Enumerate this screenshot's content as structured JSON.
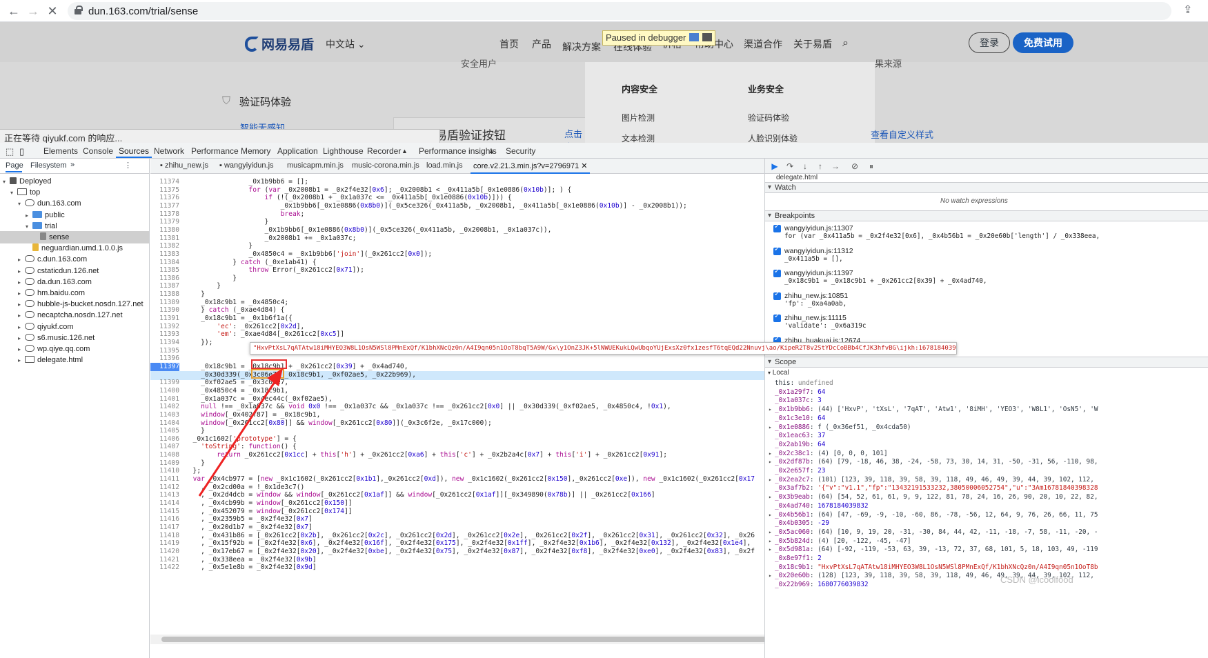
{
  "browser": {
    "url": "dun.163.com/trial/sense",
    "back_icon": "arrow-left-icon",
    "forward_icon": "arrow-right-icon",
    "stop_icon": "close-icon"
  },
  "site": {
    "logo": "网易易盾",
    "lang": "中文站",
    "nav": [
      "首页",
      "产品",
      "解决方案",
      "在线体验",
      "价格",
      "帮助中心",
      "渠道合作",
      "关于易盾"
    ],
    "login": "登录",
    "free_trial": "免费试用",
    "paused": "Paused in debugger",
    "left_heading": "验证码体验",
    "left_link": "智能无感知",
    "center_heading": "独立易盾验证按钮",
    "center_link": "点击查",
    "right_link": "查看自定义样式",
    "menu_cat1": "内容安全",
    "menu_cat2": "业务安全",
    "menu_items1": [
      "图片检测",
      "文本检测"
    ],
    "menu_items2": [
      "验证码体验",
      "人脸识别体验"
    ],
    "cut_text1": "安全用户",
    "cut_text2": "果来源",
    "status": "正在等待 qiyukf.com 的响应..."
  },
  "devtools": {
    "tabs": [
      "Elements",
      "Console",
      "Sources",
      "Network",
      "Performance",
      "Memory",
      "Application",
      "Lighthouse",
      "Recorder",
      "Performance insights",
      "Security"
    ],
    "selected_tab": "Sources",
    "nav_tabs": [
      "Page",
      "Filesystem"
    ],
    "tree": [
      {
        "label": "Deployed",
        "depth": 0,
        "kind": "cube"
      },
      {
        "label": "top",
        "depth": 1,
        "kind": "frame"
      },
      {
        "label": "dun.163.com",
        "depth": 2,
        "kind": "cloud"
      },
      {
        "label": "public",
        "depth": 3,
        "kind": "folder"
      },
      {
        "label": "trial",
        "depth": 3,
        "kind": "folder"
      },
      {
        "label": "sense",
        "depth": 4,
        "kind": "file",
        "selected": true
      },
      {
        "label": "neguardian.umd.1.0.0.js",
        "depth": 3,
        "kind": "jsfile"
      },
      {
        "label": "c.dun.163.com",
        "depth": 2,
        "kind": "cloud"
      },
      {
        "label": "cstaticdun.126.net",
        "depth": 2,
        "kind": "cloud"
      },
      {
        "label": "da.dun.163.com",
        "depth": 2,
        "kind": "cloud"
      },
      {
        "label": "hm.baidu.com",
        "depth": 2,
        "kind": "cloud"
      },
      {
        "label": "hubble-js-bucket.nosdn.127.net",
        "depth": 2,
        "kind": "cloud"
      },
      {
        "label": "necaptcha.nosdn.127.net",
        "depth": 2,
        "kind": "cloud"
      },
      {
        "label": "qiyukf.com",
        "depth": 2,
        "kind": "cloud"
      },
      {
        "label": "s6.music.126.net",
        "depth": 2,
        "kind": "cloud"
      },
      {
        "label": "wp.qiye.qq.com",
        "depth": 2,
        "kind": "cloud"
      },
      {
        "label": "delegate.html",
        "depth": 2,
        "kind": "frame"
      }
    ],
    "file_tabs": [
      "zhihu_new.js",
      "wangyiyidun.js",
      "musicapm.min.js",
      "music-corona.min.js",
      "load.min.js",
      "core.v2.21.3.min.js?v=2796971"
    ],
    "code": [
      {
        "ln": "11374",
        "t": "                _0x1b9bb6 = [];"
      },
      {
        "ln": "11375",
        "t": "                for (var _0x2008b1 = _0x2f4e32[0x6]; _0x2008b1 < _0x411a5b[_0x1e0886(0x10b)]; ) {"
      },
      {
        "ln": "11376",
        "t": "                    if (!(_0x2008b1 + _0x1a037c <= _0x411a5b[_0x1e0886(0x10b)])) {"
      },
      {
        "ln": "11377",
        "t": "                        _0x1b9bb6[_0x1e0886(0x8b0)](_0x5ce326(_0x411a5b, _0x2008b1, _0x411a5b[_0x1e0886(0x10b)] - _0x2008b1));"
      },
      {
        "ln": "11378",
        "t": "                        break;"
      },
      {
        "ln": "11379",
        "t": "                    }"
      },
      {
        "ln": "11380",
        "t": "                    _0x1b9bb6[_0x1e0886(0x8b0)](_0x5ce326(_0x411a5b, _0x2008b1, _0x1a037c)),"
      },
      {
        "ln": "11381",
        "t": "                    _0x2008b1 += _0x1a037c;"
      },
      {
        "ln": "11382",
        "t": "                }"
      },
      {
        "ln": "11383",
        "t": "                _0x4850c4 = _0x1b9bb6['join'](_0x261cc2[0x0]);"
      },
      {
        "ln": "11384",
        "t": "            } catch (_0xe1ab41) {"
      },
      {
        "ln": "11385",
        "t": "                throw Error(_0x261cc2[0x71]);"
      },
      {
        "ln": "11386",
        "t": "            }"
      },
      {
        "ln": "11387",
        "t": "        }"
      },
      {
        "ln": "11388",
        "t": "    }"
      },
      {
        "ln": "11389",
        "t": "    _0x18c9b1 = _0x4850c4;"
      },
      {
        "ln": "11390",
        "t": "    } catch (_0xae4d84) {"
      },
      {
        "ln": "11391",
        "t": "    _0x18c9b1 = _0x1b6f1a({"
      },
      {
        "ln": "11392",
        "t": "        'ec': _0x261cc2[0x2d],"
      },
      {
        "ln": "11393",
        "t": "        'em': _0xae4d84[_0x261cc2[0xc5]]"
      },
      {
        "ln": "11394",
        "t": "    });"
      },
      {
        "ln": "11395",
        "t": ""
      },
      {
        "ln": "11396",
        "t": ""
      },
      {
        "ln": "11397",
        "t": "    _0x18c9b1 = _0x18c9b1 + _0x261cc2[0x39] + _0x4ad740,"
      },
      {
        "ln": "11398",
        "t": "    _0x30d339(_0x3c06e7, _0x18c9b1, _0xf02ae5, _0x22b969),"
      },
      {
        "ln": "11399",
        "t": "    _0xf02ae5 = _0x3c06e7,"
      },
      {
        "ln": "11400",
        "t": "    _0x4850c4 = _0x18c9b1,"
      },
      {
        "ln": "11401",
        "t": "    _0x1a037c = _0x4ec44c(_0xf02ae5),"
      },
      {
        "ln": "11402",
        "t": "    null !== _0x1a037c && void 0x0 !== _0x1a037c && _0x1a037c !== _0x261cc2[0x0] || _0x30d339(_0xf02ae5, _0x4850c4, !0x1),"
      },
      {
        "ln": "11403",
        "t": "    window[_0x402f87] = _0x18c9b1,"
      },
      {
        "ln": "11404",
        "t": "    window[_0x261cc2[0x80]] && window[_0x261cc2[0x80]](_0x3c6f2e, _0x17c000);"
      },
      {
        "ln": "11405",
        "t": "    }"
      },
      {
        "ln": "11406",
        "t": "  _0x1c1602['prototype'] = {"
      },
      {
        "ln": "11407",
        "t": "    'toString': function() {"
      },
      {
        "ln": "11408",
        "t": "        return _0x261cc2[0x1cc] + this['h'] + _0x261cc2[0xa6] + this['c'] + _0x2b2a4c[0x7] + this['i'] + _0x261cc2[0x91];"
      },
      {
        "ln": "11409",
        "t": "    }"
      },
      {
        "ln": "11410",
        "t": "  };"
      },
      {
        "ln": "11411",
        "t": "  var _0x4cb977 = [new _0x1c1602(_0x261cc2[0x1b1],_0x261cc2[0xd]), new _0x1c1602(_0x261cc2[0x150],_0x261cc2[0xe]), new _0x1c1602(_0x261cc2[0x17"
      },
      {
        "ln": "11412",
        "t": "    , _0x2cd00a = !_0x1de3c7()"
      },
      {
        "ln": "11413",
        "t": "    , _0x2d4dcb = window && window[_0x261cc2[0x1af]] && window[_0x261cc2[0x1af]][_0x349890(0x78b)] || _0x261cc2[0x166]"
      },
      {
        "ln": "11414",
        "t": "    , _0x4cb99b = window[_0x261cc2[0x150]]"
      },
      {
        "ln": "11415",
        "t": "    , _0x452079 = window[_0x261cc2[0x174]]"
      },
      {
        "ln": "11416",
        "t": "    , _0x2359b5 = _0x2f4e32[0x7]"
      },
      {
        "ln": "11417",
        "t": "    , _0x20d1b7 = _0x2f4e32[0x7]"
      },
      {
        "ln": "11418",
        "t": "    , _0x431b86 = [_0x261cc2[0x2b], _0x261cc2[0x2c], _0x261cc2[0x2d], _0x261cc2[0x2e], _0x261cc2[0x2f], _0x261cc2[0x31], _0x261cc2[0x32], _0x26"
      },
      {
        "ln": "11419",
        "t": "    , _0x15f92b = [_0x2f4e32[0x6], _0x2f4e32[0x16f], _0x2f4e32[0x175], _0x2f4e32[0x1ff], _0x2f4e32[0x1b6], _0x2f4e32[0x132], _0x2f4e32[0x1e4],"
      },
      {
        "ln": "11420",
        "t": "    , _0x17eb67 = [_0x2f4e32[0x20], _0x2f4e32[0xbe], _0x2f4e32[0x75], _0x2f4e32[0x87], _0x2f4e32[0xf8], _0x2f4e32[0xe0], _0x2f4e32[0x83], _0x2f"
      },
      {
        "ln": "11421",
        "t": "    , _0x338eea = _0x2f4e32[0x9b]"
      },
      {
        "ln": "11422",
        "t": "    , _0x5e1e8b = _0x2f4e32[0x9d]"
      }
    ],
    "tooltip": "\"HxvPtXsL7qATAtw18iMHYEO3W8L1OsN5WSl8PMnExQf/K1bhXNcQz0n/A4I9qn05n1OoT8bqT5A9W/Gx\\y1OnZ3JK+5lNWUEKukLQwUbqoYUjExsXz0fx1zesfT6tqEQd22Nnuvj\\ao/KipeR2T8v2StYDcCoBBb4CfJK3hfvBG\\ijkh:1678184039832\"",
    "debugger_file": "delegate.html",
    "watch_label": "Watch",
    "watch_empty": "No watch expressions",
    "breakpoints_label": "Breakpoints",
    "breakpoints": [
      {
        "file": "wangyiyidun.js:11307",
        "code": "for (var _0x411a5b = _0x2f4e32[0x6], _0x4b56b1 = _0x20e60b['length'] / _0x338eea,"
      },
      {
        "file": "wangyiyidun.js:11312",
        "code": "_0x411a5b = [],"
      },
      {
        "file": "wangyiyidun.js:11397",
        "code": "_0x18c9b1 = _0x18c9b1 + _0x261cc2[0x39] + _0x4ad740,"
      },
      {
        "file": "zhihu_new.js:10851",
        "code": "'fp': _0xa4a0ab,"
      },
      {
        "file": "zhihu_new.js:11115",
        "code": "'validate': _0x6a319c"
      },
      {
        "file": "zhihu_huakuai.js:12674",
        "code": ""
      }
    ],
    "scope_label": "Scope",
    "local_label": "Local",
    "scope_vars": [
      {
        "n": "this",
        "v": "undefined",
        "t": "plain",
        "exp": false
      },
      {
        "n": "_0x1a29f7",
        "v": "64",
        "t": "num",
        "exp": false
      },
      {
        "n": "_0x1a037c",
        "v": "3",
        "t": "num",
        "exp": false
      },
      {
        "n": "_0x1b9bb6",
        "v": "(44) ['HxvP', 'tXsL', '7qAT', 'Atw1', '8iMH', 'YEO3', 'W8L1', 'OsN5', 'W",
        "t": "plain",
        "exp": true
      },
      {
        "n": "_0x1c3e10",
        "v": "64",
        "t": "num",
        "exp": false
      },
      {
        "n": "_0x1e0886",
        "v": "f (_0x36ef51, _0x4cda50)",
        "t": "plain",
        "exp": true
      },
      {
        "n": "_0x1eac63",
        "v": "37",
        "t": "num",
        "exp": false
      },
      {
        "n": "_0x2ab19b",
        "v": "64",
        "t": "num",
        "exp": false
      },
      {
        "n": "_0x2c38c1",
        "v": "(4) [0, 0, 0, 101]",
        "t": "plain",
        "exp": true
      },
      {
        "n": "_0x2df87b",
        "v": "(64) [79, -18, 46, 38, -24, -58, 73, 30, 14, 31, -50, -31, 56, -110, 98,",
        "t": "plain",
        "exp": true
      },
      {
        "n": "_0x2e657f",
        "v": "23",
        "t": "num",
        "exp": false
      },
      {
        "n": "_0x2ea2c7",
        "v": "(101) [123, 39, 118, 39, 58, 39, 118, 49, 46, 49, 39, 44, 39, 102, 112,",
        "t": "plain",
        "exp": true
      },
      {
        "n": "_0x3af7b2",
        "v": "'{\"v\":\"v1.1\",\"fp\":\"13432191533232,38050006052754\",\"u\":\"3Am16781840398328",
        "t": "str",
        "exp": false
      },
      {
        "n": "_0x3b9eab",
        "v": "(64) [54, 52, 61, 61, 9, 9, 122, 81, 78, 24, 16, 26, 90, 20, 10, 22, 82,",
        "t": "plain",
        "exp": true
      },
      {
        "n": "_0x4ad740",
        "v": "1678184039832",
        "t": "num",
        "exp": false
      },
      {
        "n": "_0x4b56b1",
        "v": "(64) [47, -69, -9, -10, -60, 86, -78, -56, 12, 64, 9, 76, 26, 66, 11, 75",
        "t": "plain",
        "exp": true
      },
      {
        "n": "_0x4b0305",
        "v": "-29",
        "t": "num",
        "exp": false
      },
      {
        "n": "_0x5ac060",
        "v": "(64) [10, 9, 19, 20, -31, -30, 84, 44, 42, -11, -18, -7, 58, -11, -20, -",
        "t": "plain",
        "exp": true
      },
      {
        "n": "_0x5b824d",
        "v": "(4) [20, -122, -45, -47]",
        "t": "plain",
        "exp": true
      },
      {
        "n": "_0x5d981a",
        "v": "(64) [-92, -119, -53, 63, 39, -13, 72, 37, 68, 101, 5, 18, 103, 49, -119",
        "t": "plain",
        "exp": true
      },
      {
        "n": "_0x8e97f1",
        "v": "2",
        "t": "num",
        "exp": false
      },
      {
        "n": "_0x18c9b1",
        "v": "\"HxvPtXsL7qATAtw18iMHYEO3W8L1OsN5WSl8PMnExQf/K1bhXNcQz0n/A4I9qn05n1OoT8b",
        "t": "str",
        "exp": false
      },
      {
        "n": "_0x20e60b",
        "v": "(128) [123, 39, 118, 39, 58, 39, 118, 49, 46, 49, 39, 44, 39, 102, 112,",
        "t": "plain",
        "exp": true
      },
      {
        "n": "_0x22b969",
        "v": "1680776039832",
        "t": "num",
        "exp": false
      }
    ],
    "watermark": "CSDN @icoolfood"
  }
}
